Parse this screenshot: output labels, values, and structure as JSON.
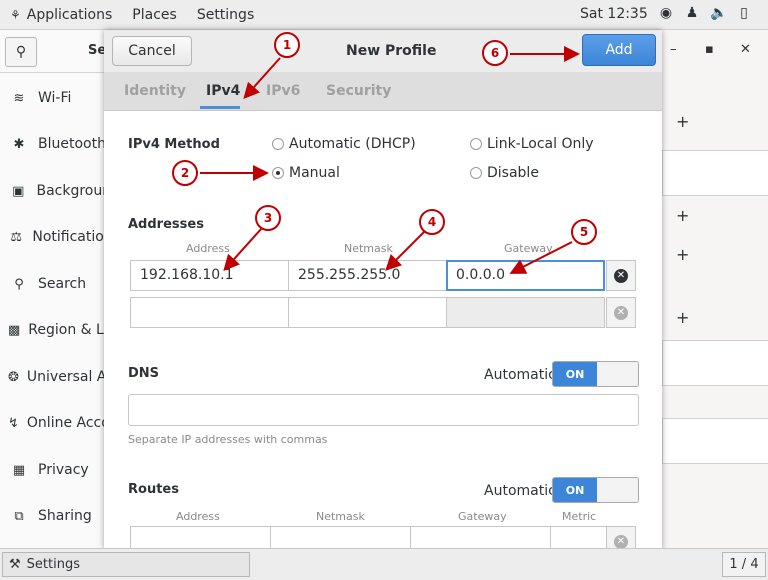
{
  "topbar": {
    "applications": "Applications",
    "places": "Places",
    "settings": "Settings",
    "clock": "Sat 12:35",
    "tray_icons": [
      "network-icon",
      "accessibility-icon",
      "volume-icon",
      "battery-icon"
    ]
  },
  "sidebar": {
    "title": "Se",
    "items": [
      {
        "label": "Wi-Fi",
        "icon": "wifi-icon"
      },
      {
        "label": "Bluetooth",
        "icon": "bluetooth-icon"
      },
      {
        "label": "Background",
        "icon": "background-icon"
      },
      {
        "label": "Notifications",
        "icon": "notifications-icon"
      },
      {
        "label": "Search",
        "icon": "search-icon"
      },
      {
        "label": "Region & Language",
        "icon": "region-icon"
      },
      {
        "label": "Universal Access",
        "icon": "universal-access-icon"
      },
      {
        "label": "Online Accounts",
        "icon": "online-accounts-icon"
      },
      {
        "label": "Privacy",
        "icon": "privacy-icon"
      },
      {
        "label": "Sharing",
        "icon": "sharing-icon"
      }
    ]
  },
  "dialog": {
    "title": "New Profile",
    "cancel": "Cancel",
    "add": "Add",
    "tabs": [
      "Identity",
      "IPv4",
      "IPv6",
      "Security"
    ],
    "active_tab": "IPv4",
    "method_label": "IPv4 Method",
    "methods": {
      "dhcp": "Automatic (DHCP)",
      "link_local": "Link-Local Only",
      "manual": "Manual",
      "disable": "Disable"
    },
    "selected_method": "Manual",
    "addresses": {
      "label": "Addresses",
      "headers": [
        "Address",
        "Netmask",
        "Gateway"
      ],
      "rows": [
        {
          "address": "192.168.10.1",
          "netmask": "255.255.255.0",
          "gateway": "0.0.0.0"
        },
        {
          "address": "",
          "netmask": "",
          "gateway": ""
        }
      ]
    },
    "dns": {
      "label": "DNS",
      "auto_label": "Automatic",
      "switch": "ON",
      "value": "",
      "hint": "Separate IP addresses with commas"
    },
    "routes": {
      "label": "Routes",
      "auto_label": "Automatic",
      "switch": "ON",
      "headers": [
        "Address",
        "Netmask",
        "Gateway",
        "Metric"
      ]
    }
  },
  "annotations": [
    "1",
    "2",
    "3",
    "4",
    "5",
    "6"
  ],
  "annotation_color": "#c00000",
  "taskbar": {
    "item": "Settings",
    "pager": "1 / 4"
  }
}
